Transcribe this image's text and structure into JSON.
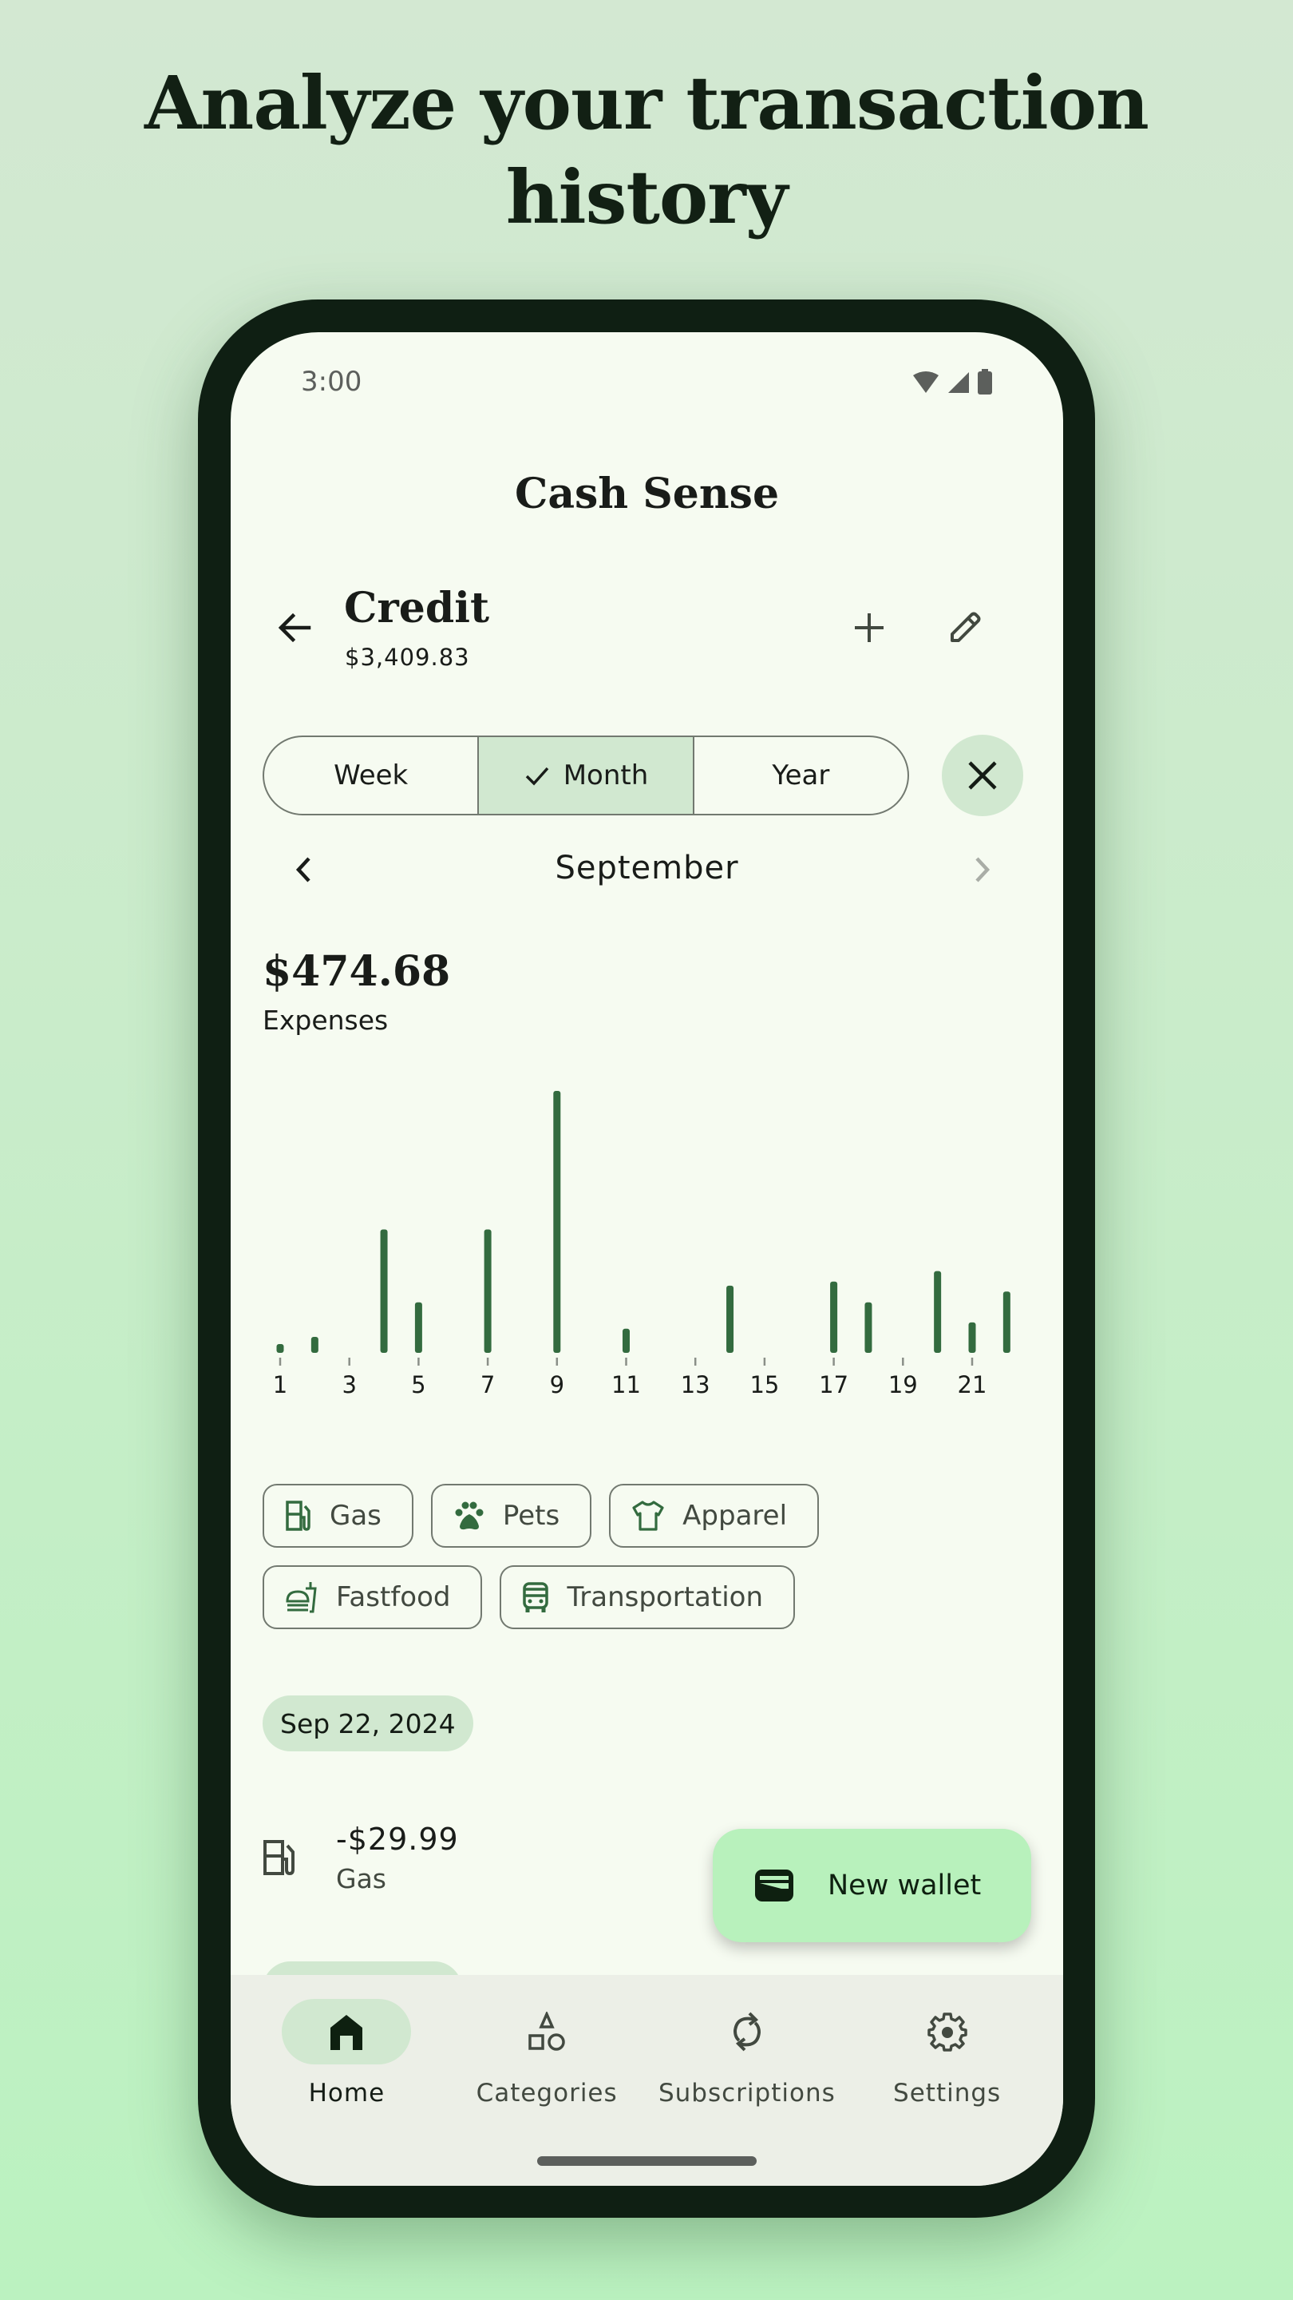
{
  "headline": {
    "line1": "Analyze your transaction",
    "line2": "history"
  },
  "status_bar": {
    "time": "3:00",
    "icons": [
      "wifi-icon",
      "signal-icon",
      "battery-icon"
    ]
  },
  "app": {
    "title": "Cash Sense"
  },
  "wallet": {
    "name": "Credit",
    "balance": "$3,409.83",
    "actions": {
      "back": "arrow-back-icon",
      "add": "plus-icon",
      "edit": "pencil-icon"
    }
  },
  "period_selector": {
    "options": [
      {
        "label": "Week",
        "selected": false
      },
      {
        "label": "Month",
        "selected": true
      },
      {
        "label": "Year",
        "selected": false
      }
    ],
    "close_icon": "close-icon"
  },
  "month_nav": {
    "label": "September",
    "prev_icon": "chevron-left-icon",
    "next_icon": "chevron-right-icon",
    "next_enabled": false
  },
  "summary": {
    "total": "$474.68",
    "label": "Expenses"
  },
  "chart_data": {
    "type": "bar",
    "title": "",
    "xlabel": "",
    "ylabel": "",
    "x_range": [
      1,
      22
    ],
    "tick_labels": [
      "1",
      "3",
      "5",
      "7",
      "9",
      "11",
      "13",
      "15",
      "17",
      "19",
      "21"
    ],
    "tick_days": [
      1,
      3,
      5,
      7,
      9,
      11,
      13,
      15,
      17,
      19,
      21
    ],
    "categories": [
      "1",
      "2",
      "4",
      "5",
      "7",
      "9",
      "11",
      "14",
      "17",
      "18",
      "20",
      "21",
      "22"
    ],
    "x": [
      1,
      2,
      4,
      5,
      7,
      9,
      11,
      14,
      17,
      18,
      20,
      21,
      22
    ],
    "values": [
      4.3,
      7.8,
      60.4,
      24.7,
      60.4,
      128.2,
      11.8,
      32.9,
      34.9,
      24.7,
      40.0,
      14.9,
      29.99
    ],
    "ylim": [
      0,
      128.2
    ],
    "grid": false,
    "bar_color": "#336b3f",
    "tick_color": "#8a8f88"
  },
  "categories": [
    {
      "label": "Gas",
      "icon": "gas-station-icon"
    },
    {
      "label": "Pets",
      "icon": "paw-icon"
    },
    {
      "label": "Apparel",
      "icon": "shirt-icon"
    },
    {
      "label": "Fastfood",
      "icon": "fastfood-icon"
    },
    {
      "label": "Transportation",
      "icon": "bus-icon"
    }
  ],
  "transactions": {
    "groups": [
      {
        "date": "Sep 22, 2024",
        "items": [
          {
            "amount": "-$29.99",
            "category": "Gas",
            "icon": "gas-station-icon"
          }
        ]
      }
    ]
  },
  "fab": {
    "label": "New wallet",
    "icon": "wallet-icon"
  },
  "bottom_nav": {
    "items": [
      {
        "label": "Home",
        "icon": "home-icon",
        "active": true
      },
      {
        "label": "Categories",
        "icon": "shapes-icon",
        "active": false
      },
      {
        "label": "Subscriptions",
        "icon": "sync-icon",
        "active": false
      },
      {
        "label": "Settings",
        "icon": "gear-icon",
        "active": false
      }
    ]
  },
  "colors": {
    "accent": "#336b3f",
    "secondary_container": "#d1e8d0",
    "fab": "#b8f1bc",
    "surface": "#f6fbf1",
    "frame": "#0f1f13"
  }
}
